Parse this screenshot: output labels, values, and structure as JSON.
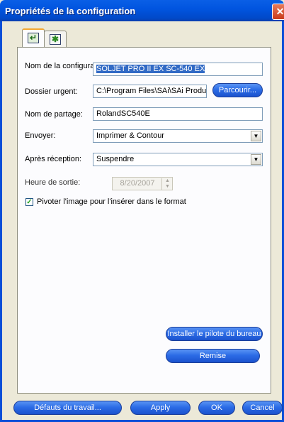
{
  "window": {
    "title": "Propriétés de la configuration"
  },
  "tabs": [
    {
      "icon": "printer-properties-icon",
      "selected": true
    },
    {
      "icon": "document-settings-icon",
      "selected": false
    }
  ],
  "form": {
    "config_name_label": "Nom de la configuration:",
    "config_name_value": "SOLJET PRO II EX SC-540 EX",
    "urgent_folder_label": "Dossier urgent:",
    "urgent_folder_value": "C:\\Program Files\\SAi\\SAi Produc",
    "browse_label": "Parcourir...",
    "share_name_label": "Nom de partage:",
    "share_name_value": "RolandSC540E",
    "send_label": "Envoyer:",
    "send_value": "Imprimer & Contour",
    "after_receive_label": "Après réception:",
    "after_receive_value": "Suspendre",
    "output_time_label": "Heure de sortie:",
    "output_time_value": "8/20/2007",
    "rotate_label": "Pivoter l'image pour l'insérer dans le format",
    "rotate_checked": true
  },
  "panel_buttons": {
    "install_driver_label": "Installer le pilote du bureau",
    "reset_label": "Remise"
  },
  "footer": {
    "job_defaults_label": "Défauts du travail...",
    "apply_label": "Apply",
    "ok_label": "OK",
    "cancel_label": "Cancel"
  }
}
